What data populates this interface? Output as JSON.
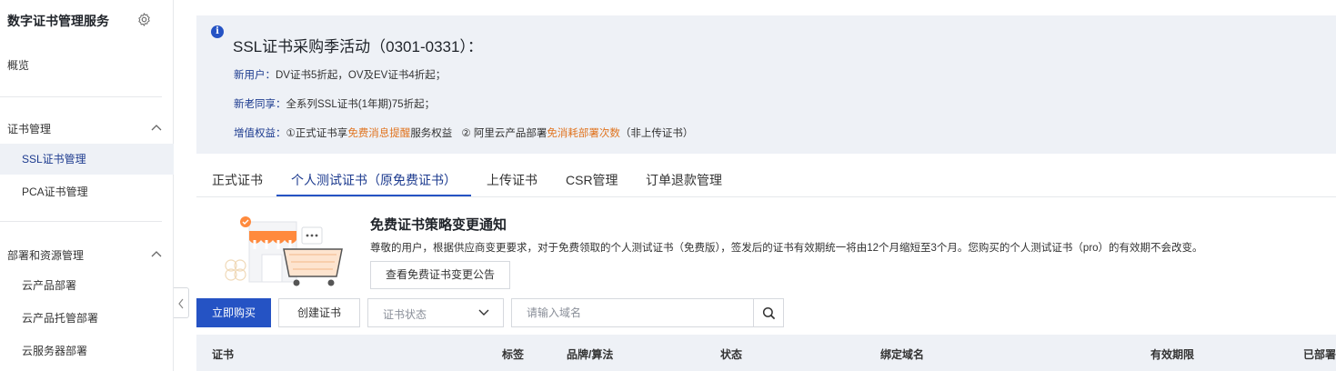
{
  "sidebar": {
    "title": "数字证书管理服务",
    "overview": "概览",
    "groups": [
      {
        "label": "证书管理",
        "items": [
          "SSL证书管理",
          "PCA证书管理"
        ]
      },
      {
        "label": "部署和资源管理",
        "items": [
          "云产品部署",
          "云产品托管部署",
          "云服务器部署"
        ]
      }
    ],
    "active_item": "SSL证书管理"
  },
  "banner": {
    "title": "SSL证书采购季活动（0301-0331）：",
    "line1": {
      "key": "新用户：",
      "text": "DV证书5折起，OV及EV证书4折起；"
    },
    "line2": {
      "key": "新老同享：",
      "text": "全系列SSL证书(1年期)75折起；"
    },
    "line3": {
      "key": "增值权益：",
      "part1": "①正式证书享",
      "highlight1": "免费消息提醒",
      "part2": "服务权益",
      "part3": "② 阿里云产品部署",
      "highlight2": "免消耗部署次数",
      "part4": "（非上传证书）"
    },
    "highlight_color": "#e07420"
  },
  "tabs": [
    "正式证书",
    "个人测试证书（原免费证书）",
    "上传证书",
    "CSR管理",
    "订单退款管理"
  ],
  "active_tab": "个人测试证书（原免费证书）",
  "notice": {
    "title": "免费证书策略变更通知",
    "description": "尊敬的用户，根据供应商变更要求，对于免费领取的个人测试证书（免费版），签发后的证书有效期统一将由12个月缩短至3个月。您购买的个人测试证书（pro）的有效期不会改变。",
    "button": "查看免费证书变更公告"
  },
  "toolbar": {
    "buy": "立即购买",
    "create": "创建证书",
    "status_placeholder": "证书状态",
    "search_placeholder": "请输入域名"
  },
  "table": {
    "columns": [
      "证书",
      "标签",
      "品牌/算法",
      "状态",
      "绑定域名",
      "有效期限",
      "已部署"
    ]
  },
  "colors": {
    "primary": "#2553c4",
    "accent_text": "#1d3b8f",
    "panel_bg": "#eef1f6"
  }
}
